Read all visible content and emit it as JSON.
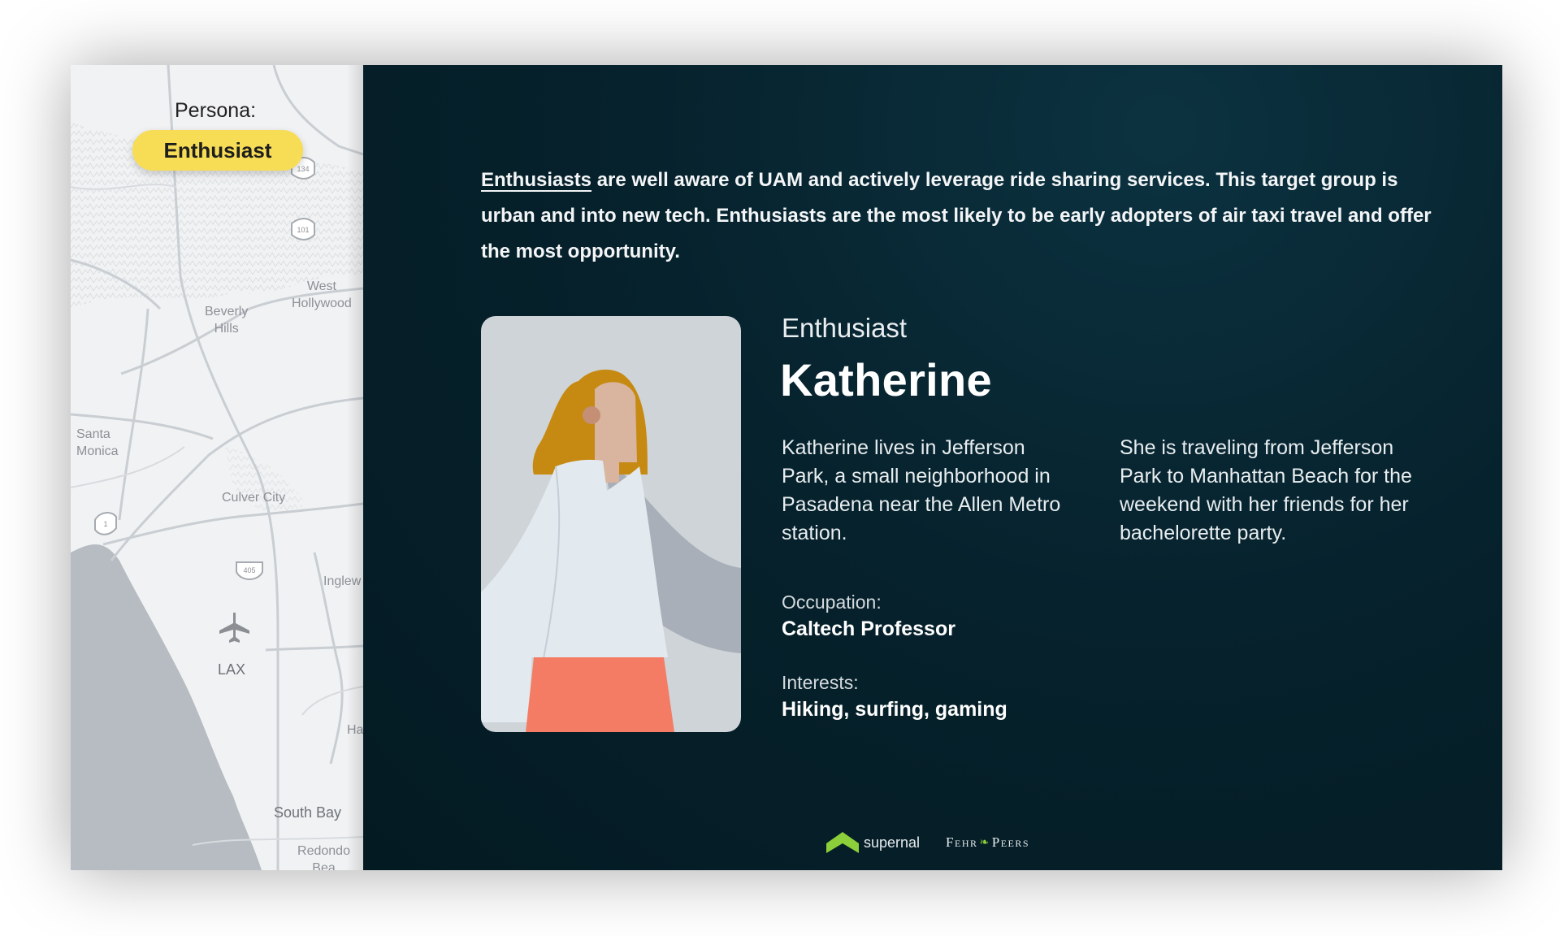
{
  "map": {
    "persona_label": "Persona:",
    "persona_pill": "Enthusiast",
    "places": {
      "west_hollywood": "West\nHollywood",
      "beverly_hills": "Beverly\nHills",
      "santa_monica": "Santa\nMonica",
      "culver_city": "Culver City",
      "inglewood": "Inglew",
      "lax": "LAX",
      "ha": "Ha",
      "south_bay": "South Bay",
      "redondo": "Redondo Bea"
    },
    "shields": {
      "hwy_134": "134",
      "hwy_101": "101",
      "hwy_1": "1",
      "hwy_405": "405"
    }
  },
  "intro": {
    "keyword": "Enthusiasts",
    "rest": " are well aware of UAM and actively leverage ride sharing services. This target group is urban and into new tech. Enthusiasts are the most likely to be early adopters of air taxi travel and offer the most opportunity."
  },
  "persona": {
    "type": "Enthusiast",
    "name": "Katherine",
    "bio_left": "Katherine lives in Jefferson Park, a small neighborhood in Pasadena near the Allen Metro station.",
    "bio_right": "She is traveling from Jefferson Park to Manhattan Beach for the weekend with her friends for her bachelorette party.",
    "occupation_label": "Occupation:",
    "occupation": "Caltech Professor",
    "interests_label": "Interests:",
    "interests": "Hiking, surfing, gaming"
  },
  "logos": {
    "supernal": "supernal",
    "fehr_left": "Fehr",
    "fehr_right": "Peers"
  },
  "colors": {
    "pill": "#f7dc55",
    "panel_dark": "#041a22",
    "hair": "#c68a12",
    "skirt": "#f47c65",
    "supernal_green": "#8ccf3a"
  }
}
